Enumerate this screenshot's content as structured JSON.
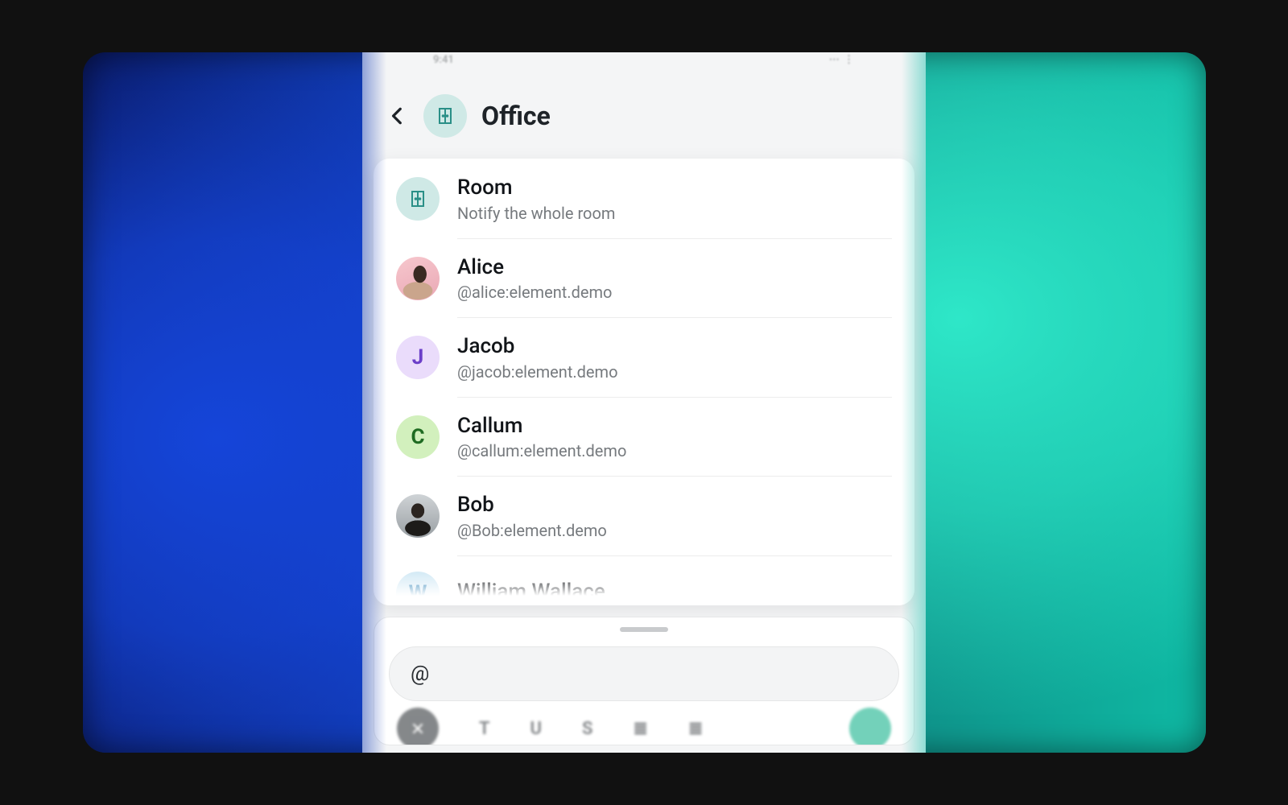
{
  "status": {
    "time": "9:41",
    "system": "⋯ ⋮"
  },
  "header": {
    "room_name": "Office"
  },
  "suggestions": [
    {
      "name": "Room",
      "sub": "Notify the whole room",
      "avatar_initial": "",
      "avatar_class": "av-room"
    },
    {
      "name": "Alice",
      "sub": "@alice:element.demo",
      "avatar_initial": "",
      "avatar_class": "av-alice"
    },
    {
      "name": "Jacob",
      "sub": "@jacob:element.demo",
      "avatar_initial": "J",
      "avatar_class": "av-jacob"
    },
    {
      "name": "Callum",
      "sub": "@callum:element.demo",
      "avatar_initial": "C",
      "avatar_class": "av-callum"
    },
    {
      "name": "Bob",
      "sub": "@Bob:element.demo",
      "avatar_initial": "",
      "avatar_class": "av-bob"
    },
    {
      "name": "William Wallace",
      "sub": "",
      "avatar_initial": "W",
      "avatar_class": "av-will"
    }
  ],
  "composer": {
    "text": "@"
  },
  "colors": {
    "accent": "#17b38c",
    "room_icon": "#2a8f87"
  }
}
